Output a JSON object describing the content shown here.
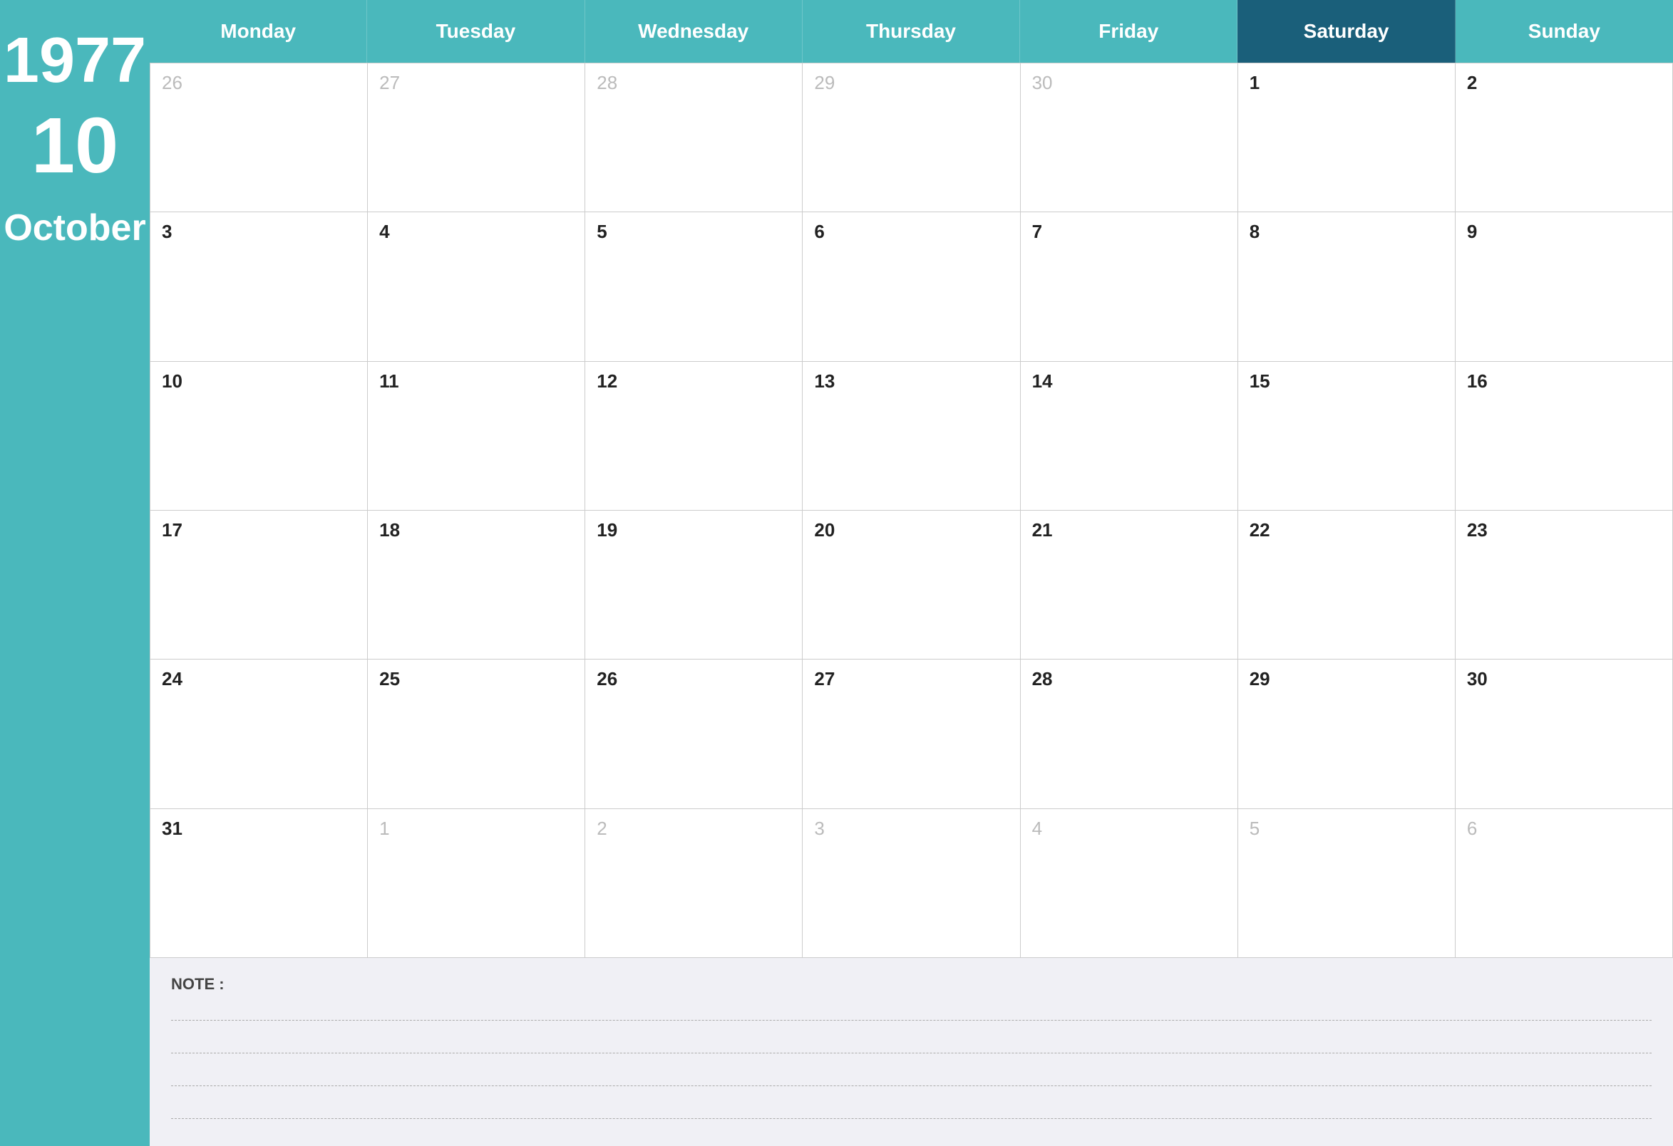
{
  "sidebar": {
    "year": "1977",
    "month_number": "10",
    "month_name": "October"
  },
  "header": {
    "days": [
      {
        "label": "Monday",
        "highlight": false
      },
      {
        "label": "Tuesday",
        "highlight": false
      },
      {
        "label": "Wednesday",
        "highlight": false
      },
      {
        "label": "Thursday",
        "highlight": false
      },
      {
        "label": "Friday",
        "highlight": false
      },
      {
        "label": "Saturday",
        "highlight": true
      },
      {
        "label": "Sunday",
        "highlight": false
      }
    ]
  },
  "weeks": [
    [
      {
        "num": "26",
        "other": true
      },
      {
        "num": "27",
        "other": true
      },
      {
        "num": "28",
        "other": true
      },
      {
        "num": "29",
        "other": true
      },
      {
        "num": "30",
        "other": true
      },
      {
        "num": "1",
        "other": false
      },
      {
        "num": "2",
        "other": false
      }
    ],
    [
      {
        "num": "3",
        "other": false
      },
      {
        "num": "4",
        "other": false
      },
      {
        "num": "5",
        "other": false
      },
      {
        "num": "6",
        "other": false
      },
      {
        "num": "7",
        "other": false
      },
      {
        "num": "8",
        "other": false
      },
      {
        "num": "9",
        "other": false
      }
    ],
    [
      {
        "num": "10",
        "other": false
      },
      {
        "num": "11",
        "other": false
      },
      {
        "num": "12",
        "other": false
      },
      {
        "num": "13",
        "other": false
      },
      {
        "num": "14",
        "other": false
      },
      {
        "num": "15",
        "other": false
      },
      {
        "num": "16",
        "other": false
      }
    ],
    [
      {
        "num": "17",
        "other": false
      },
      {
        "num": "18",
        "other": false
      },
      {
        "num": "19",
        "other": false
      },
      {
        "num": "20",
        "other": false
      },
      {
        "num": "21",
        "other": false
      },
      {
        "num": "22",
        "other": false
      },
      {
        "num": "23",
        "other": false
      }
    ],
    [
      {
        "num": "24",
        "other": false
      },
      {
        "num": "25",
        "other": false
      },
      {
        "num": "26",
        "other": false
      },
      {
        "num": "27",
        "other": false
      },
      {
        "num": "28",
        "other": false
      },
      {
        "num": "29",
        "other": false
      },
      {
        "num": "30",
        "other": false
      }
    ],
    [
      {
        "num": "31",
        "other": false
      },
      {
        "num": "1",
        "other": true
      },
      {
        "num": "2",
        "other": true
      },
      {
        "num": "3",
        "other": true
      },
      {
        "num": "4",
        "other": true
      },
      {
        "num": "5",
        "other": true
      },
      {
        "num": "6",
        "other": true
      }
    ]
  ],
  "notes": {
    "label": "NOTE :",
    "lines": 4
  }
}
